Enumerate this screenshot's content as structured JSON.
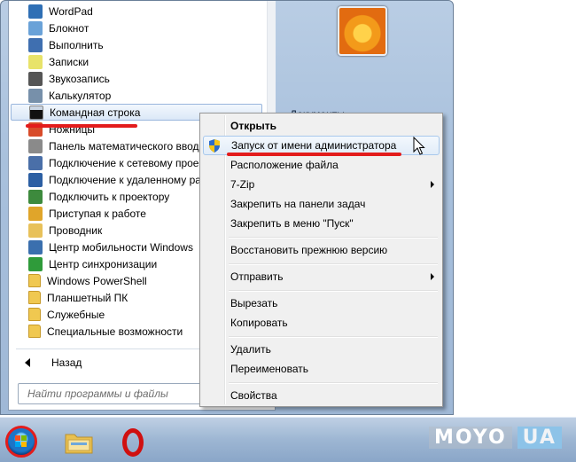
{
  "programs": [
    {
      "label": "WordPad",
      "icon": "wordpad-icon",
      "color": "#2f6fb5"
    },
    {
      "label": "Блокнот",
      "icon": "notepad-icon",
      "color": "#6aa2d8"
    },
    {
      "label": "Выполнить",
      "icon": "run-icon",
      "color": "#3f6fb0"
    },
    {
      "label": "Записки",
      "icon": "sticky-notes-icon",
      "color": "#e8e36a"
    },
    {
      "label": "Звукозапись",
      "icon": "microphone-icon",
      "color": "#555555"
    },
    {
      "label": "Калькулятор",
      "icon": "calculator-icon",
      "color": "#7790aa"
    },
    {
      "label": "Командная строка",
      "icon": "command-prompt-icon",
      "color": "#111111"
    },
    {
      "label": "Ножницы",
      "icon": "scissors-icon",
      "color": "#d84c2a"
    },
    {
      "label": "Панель математического ввода",
      "icon": "math-input-icon",
      "color": "#8a8a8a"
    },
    {
      "label": "Подключение к сетевому проектору",
      "icon": "network-projector-icon",
      "color": "#4a6fa8"
    },
    {
      "label": "Подключение к удаленному рабочему столу",
      "icon": "remote-desktop-icon",
      "color": "#2c5fa3"
    },
    {
      "label": "Подключить к проектору",
      "icon": "projector-icon",
      "color": "#3d8a3d"
    },
    {
      "label": "Приступая к работе",
      "icon": "getting-started-icon",
      "color": "#e0a52a"
    },
    {
      "label": "Проводник",
      "icon": "explorer-icon",
      "color": "#e8c15a"
    },
    {
      "label": "Центр мобильности Windows",
      "icon": "mobility-center-icon",
      "color": "#3a6fae"
    },
    {
      "label": "Центр синхронизации",
      "icon": "sync-center-icon",
      "color": "#2f9b3a"
    },
    {
      "label": "Windows PowerShell",
      "icon": "folder-icon",
      "color": "#f0c850"
    },
    {
      "label": "Планшетный ПК",
      "icon": "folder-icon",
      "color": "#f0c850"
    },
    {
      "label": "Служебные",
      "icon": "folder-icon",
      "color": "#f0c850"
    },
    {
      "label": "Специальные возможности",
      "icon": "folder-icon",
      "color": "#f0c850"
    }
  ],
  "back_label": "Назад",
  "search_placeholder": "Найти программы и файлы",
  "right_pane": {
    "docs_label": "Документы"
  },
  "context_menu": [
    {
      "label": "Открыть",
      "bold": true
    },
    {
      "label": "Запуск от имени администратора",
      "shield": true,
      "highlight": true
    },
    {
      "label": "Расположение файла"
    },
    {
      "label": "7-Zip",
      "submenu": true
    },
    {
      "label": "Закрепить на панели задач"
    },
    {
      "label": "Закрепить в меню \"Пуск\""
    },
    {
      "sep": true
    },
    {
      "label": "Восстановить прежнюю версию"
    },
    {
      "sep": true
    },
    {
      "label": "Отправить",
      "submenu": true
    },
    {
      "sep": true
    },
    {
      "label": "Вырезать"
    },
    {
      "label": "Копировать"
    },
    {
      "sep": true
    },
    {
      "label": "Удалить"
    },
    {
      "label": "Переименовать"
    },
    {
      "sep": true
    },
    {
      "label": "Свойства"
    }
  ],
  "taskbar": {
    "buttons": [
      "start-orb",
      "windows-explorer",
      "opera-browser"
    ]
  },
  "watermark": {
    "part1": "MOYO",
    "part2": "UA"
  },
  "colors": {
    "highlight_underline": "#e31c1c",
    "accent": "#1d74c6"
  }
}
